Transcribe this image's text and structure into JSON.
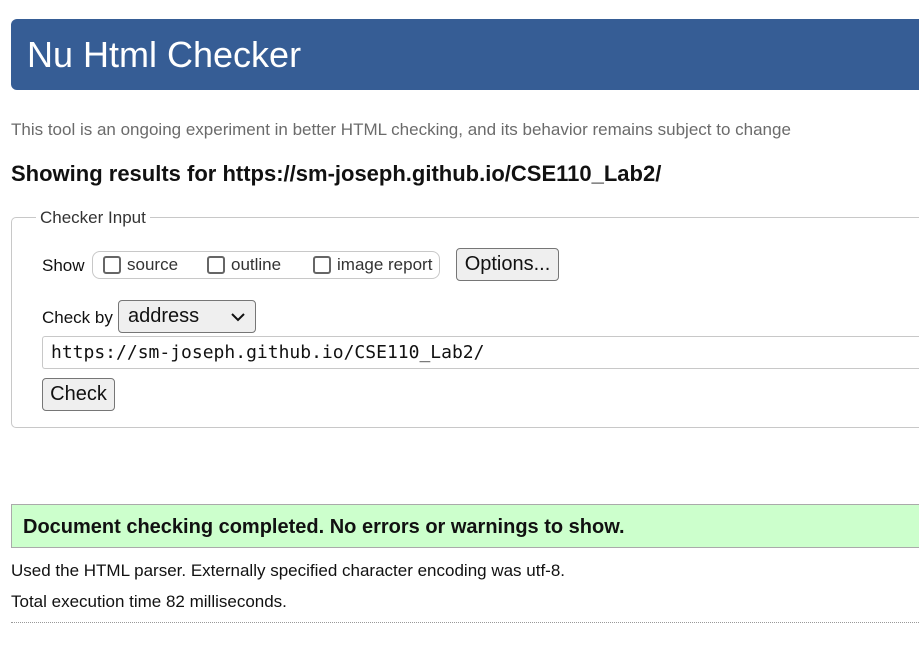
{
  "header": {
    "title": "Nu Html Checker"
  },
  "tagline": "This tool is an ongoing experiment in better HTML checking, and its behavior remains subject to change",
  "results_heading": "Showing results for https://sm-joseph.github.io/CSE110_Lab2/",
  "checker_input": {
    "legend": "Checker Input",
    "show_label": "Show",
    "show_options": [
      {
        "label": "source",
        "checked": false
      },
      {
        "label": "outline",
        "checked": false
      },
      {
        "label": "image report",
        "checked": false
      }
    ],
    "options_button": "Options...",
    "check_by_label": "Check by",
    "check_by_value": "address",
    "url_value": "https://sm-joseph.github.io/CSE110_Lab2/",
    "check_button": "Check"
  },
  "result": {
    "success_message": "Document checking completed. No errors or warnings to show.",
    "parser_info": "Used the HTML parser. Externally specified character encoding was utf-8.",
    "execution_time": "Total execution time 82 milliseconds."
  },
  "colors": {
    "header_bg": "#365d95",
    "success_bg": "#ccffcc"
  },
  "icons": {
    "select_arrow": "chevron-down-icon"
  }
}
